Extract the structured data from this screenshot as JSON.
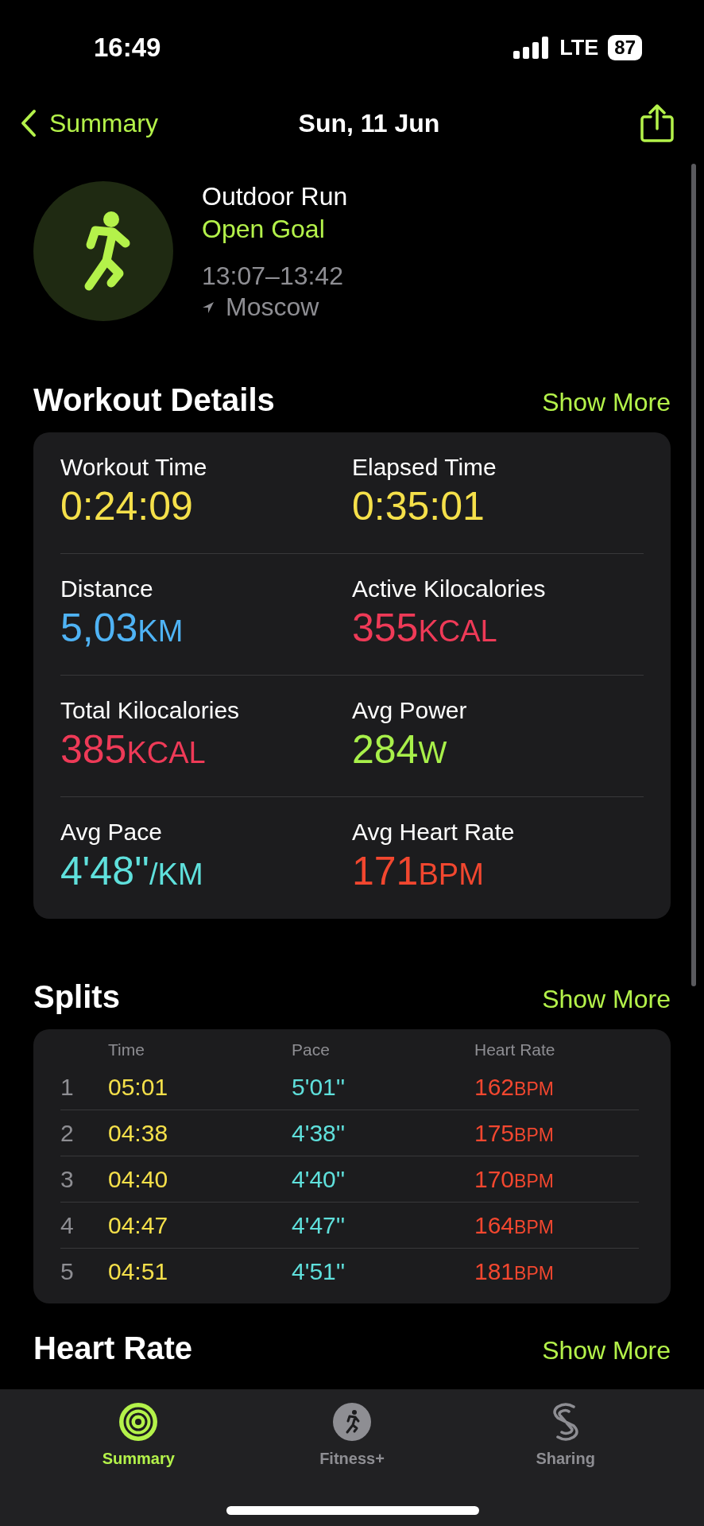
{
  "status_bar": {
    "time": "16:49",
    "network": "LTE",
    "battery": "87"
  },
  "nav": {
    "back": "Summary",
    "title": "Sun, 11 Jun"
  },
  "workout": {
    "name": "Outdoor Run",
    "goal": "Open Goal",
    "time_range": "13:07–13:42",
    "location": "Moscow"
  },
  "details": {
    "title": "Workout Details",
    "action": "Show More",
    "metrics": [
      {
        "label": "Workout Time",
        "value": "0:24:09",
        "color": "#f5e04a"
      },
      {
        "label": "Elapsed Time",
        "value": "0:35:01",
        "color": "#f5e04a"
      },
      {
        "label": "Distance",
        "value": "5,03",
        "unit": "KM",
        "color": "#4fb3f5"
      },
      {
        "label": "Active Kilocalories",
        "value": "355",
        "unit": "KCAL",
        "color": "#ee3a57"
      },
      {
        "label": "Total Kilocalories",
        "value": "385",
        "unit": "KCAL",
        "color": "#ee3a57"
      },
      {
        "label": "Avg Power",
        "value": "284",
        "unit": "W",
        "color": "#a8f04a"
      },
      {
        "label": "Avg Pace",
        "value": "4'48''",
        "unit": "/KM",
        "color": "#5fe0dc"
      },
      {
        "label": "Avg Heart Rate",
        "value": "171",
        "unit": "BPM",
        "color": "#f2472f"
      }
    ]
  },
  "splits": {
    "title": "Splits",
    "action": "Show More",
    "columns": [
      "Time",
      "Pace",
      "Heart Rate"
    ],
    "rows": [
      {
        "index": "1",
        "time": "05:01",
        "pace": "5'01''",
        "heart_rate": "162",
        "unit": "BPM"
      },
      {
        "index": "2",
        "time": "04:38",
        "pace": "4'38''",
        "heart_rate": "175",
        "unit": "BPM"
      },
      {
        "index": "3",
        "time": "04:40",
        "pace": "4'40''",
        "heart_rate": "170",
        "unit": "BPM"
      },
      {
        "index": "4",
        "time": "04:47",
        "pace": "4'47''",
        "heart_rate": "164",
        "unit": "BPM"
      },
      {
        "index": "5",
        "time": "04:51",
        "pace": "4'51''",
        "heart_rate": "181",
        "unit": "BPM"
      }
    ]
  },
  "heart_rate": {
    "title": "Heart Rate",
    "action": "Show More"
  },
  "tabs": [
    {
      "label": "Summary",
      "kind": "rings",
      "selected": true
    },
    {
      "label": "Fitness+",
      "kind": "fitness",
      "selected": false
    },
    {
      "label": "Sharing",
      "kind": "sharing",
      "selected": false
    }
  ]
}
